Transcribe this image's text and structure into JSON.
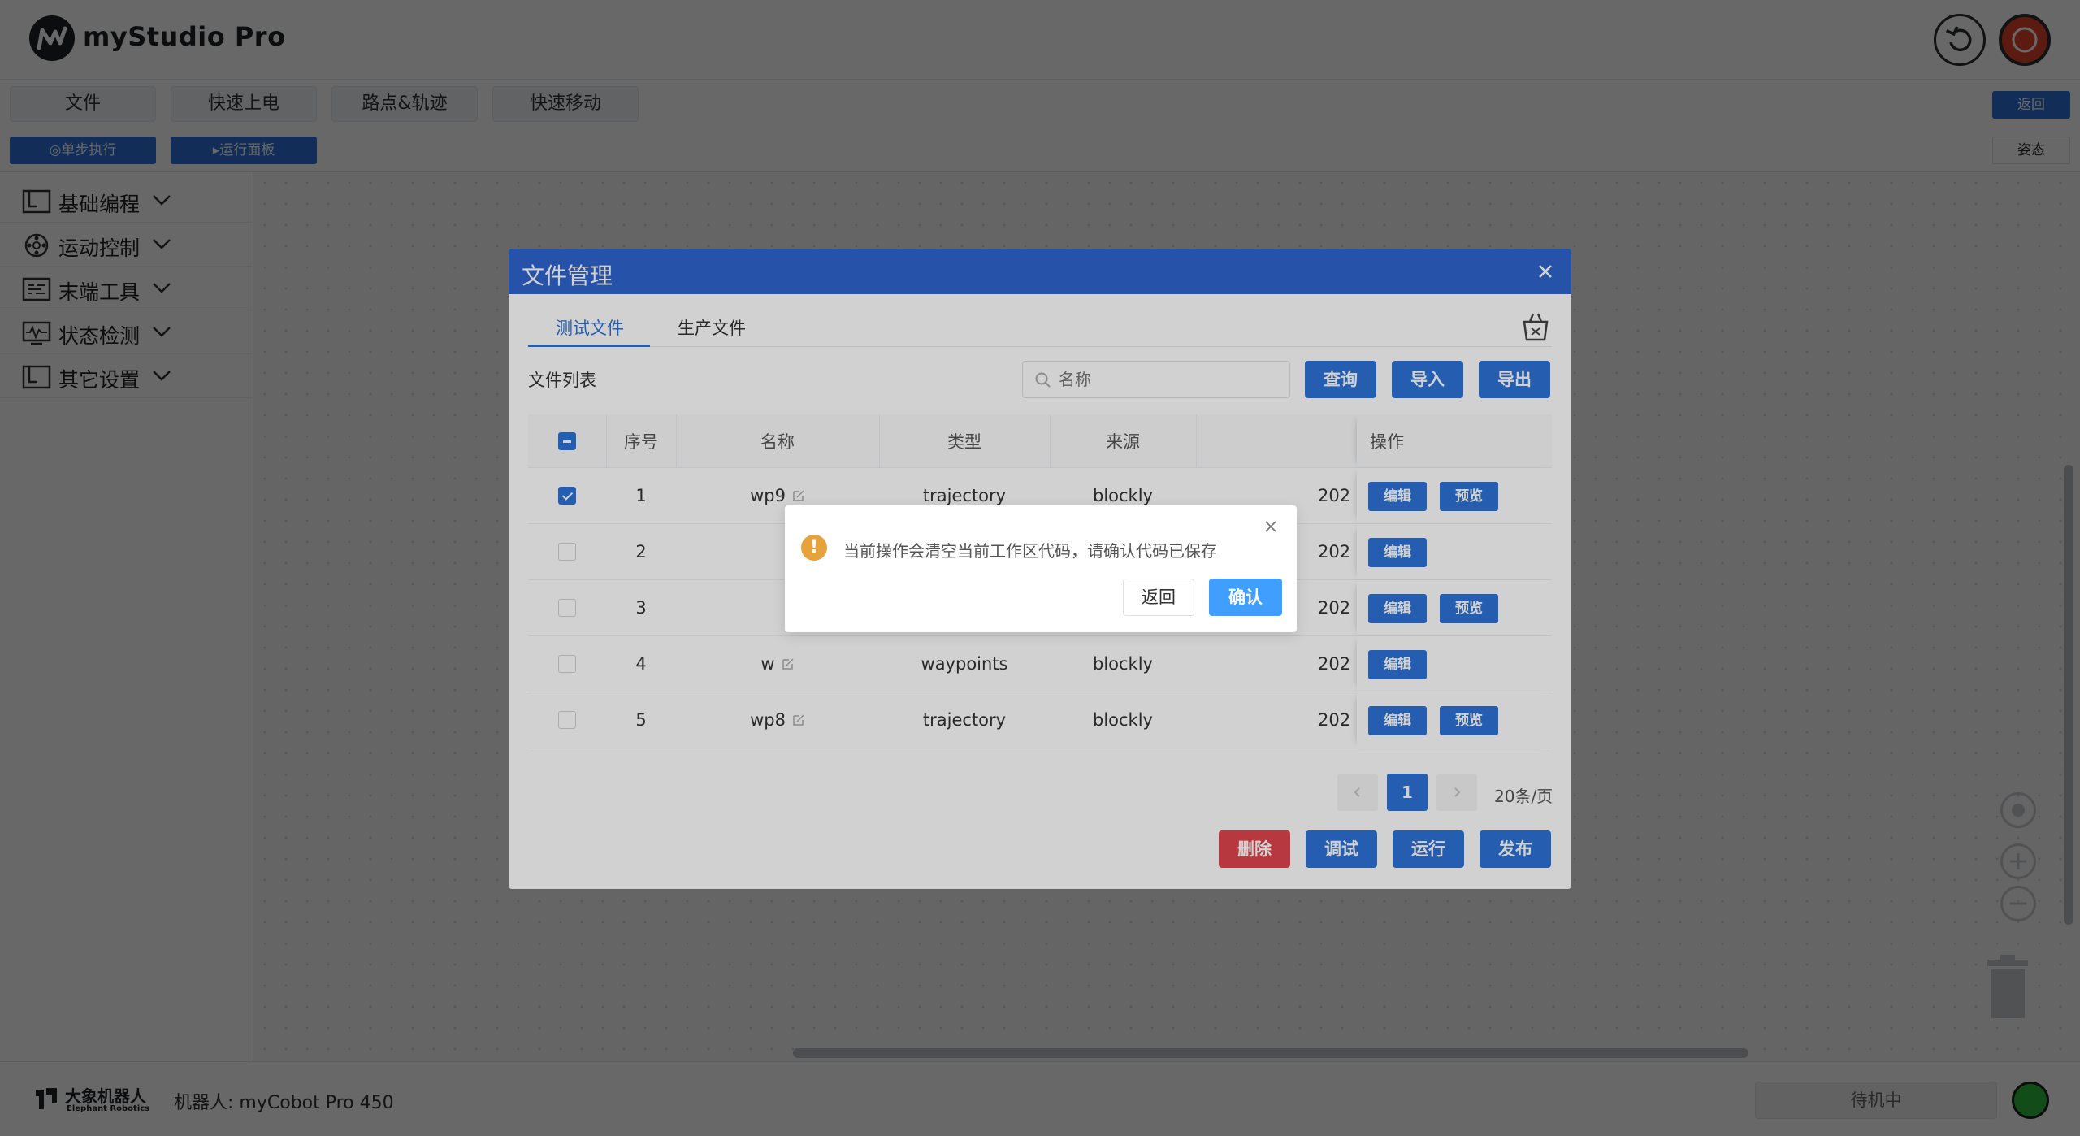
{
  "app": {
    "title": "myStudio Pro"
  },
  "menu": {
    "tabs": [
      "文件",
      "快速上电",
      "路点&轨迹",
      "快速移动"
    ],
    "back_label": "返回"
  },
  "toolbar": {
    "step_label": "◎单步执行",
    "run_panel_label": "▸运行面板",
    "pose_label": "姿态"
  },
  "sidebar": {
    "items": [
      {
        "label": "基础编程",
        "icon": "block-icon"
      },
      {
        "label": "运动控制",
        "icon": "motion-icon"
      },
      {
        "label": "末端工具",
        "icon": "tool-icon"
      },
      {
        "label": "状态检测",
        "icon": "monitor-icon"
      },
      {
        "label": "其它设置",
        "icon": "flag-icon"
      }
    ]
  },
  "footer": {
    "brand_cn": "大象机器人",
    "brand_en": "Elephant Robotics",
    "robot_label": "机器人: myCobot Pro 450",
    "status_label": "待机中",
    "status_color": "#2fbe3f"
  },
  "file_dialog": {
    "title": "文件管理",
    "tabs": [
      "测试文件",
      "生产文件"
    ],
    "active_tab": "测试文件",
    "list_label": "文件列表",
    "search_placeholder": "名称",
    "buttons": {
      "query": "查询",
      "import": "导入",
      "export": "导出",
      "delete": "删除",
      "debug": "调试",
      "run": "运行",
      "publish": "发布"
    },
    "columns": [
      "序号",
      "名称",
      "类型",
      "来源",
      "操作"
    ],
    "rows": [
      {
        "index": "1",
        "name": "wp9",
        "type": "trajectory",
        "source": "blockly",
        "date": "202",
        "checked": true,
        "actions": [
          "编辑",
          "预览"
        ]
      },
      {
        "index": "2",
        "name": "",
        "type": "",
        "source": "",
        "date": "202",
        "checked": false,
        "actions": [
          "编辑"
        ]
      },
      {
        "index": "3",
        "name": "",
        "type": "",
        "source": "",
        "date": "202",
        "checked": false,
        "actions": [
          "编辑",
          "预览"
        ]
      },
      {
        "index": "4",
        "name": "w",
        "type": "waypoints",
        "source": "blockly",
        "date": "202",
        "checked": false,
        "actions": [
          "编辑"
        ]
      },
      {
        "index": "5",
        "name": "wp8",
        "type": "trajectory",
        "source": "blockly",
        "date": "202",
        "checked": false,
        "actions": [
          "编辑",
          "预览"
        ]
      }
    ],
    "pagination": {
      "current_page": "1",
      "page_size_label": "20条/页"
    }
  },
  "confirm": {
    "message": "当前操作会清空当前工作区代码，请确认代码已保存",
    "back_label": "返回",
    "ok_label": "确认",
    "warn_glyph": "!"
  },
  "colors": {
    "primary": "#2e73d8",
    "dialog_header": "#2f64cf",
    "danger": "#e0454e",
    "warning": "#e6a23c",
    "confirm_button": "#409eff"
  }
}
